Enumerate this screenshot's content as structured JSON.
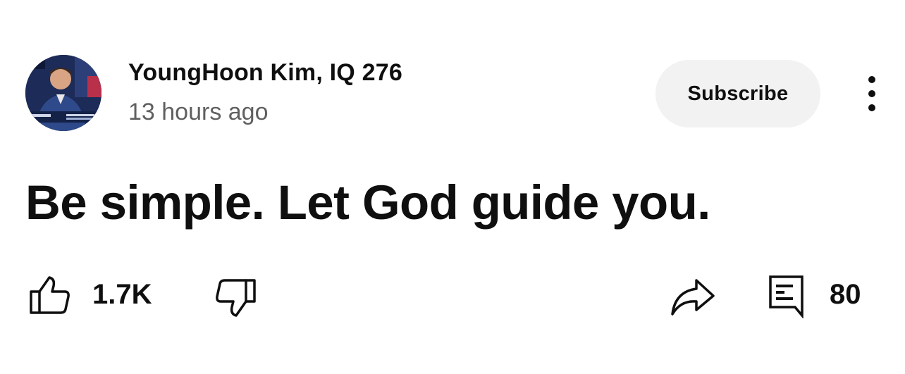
{
  "post": {
    "channel_name": "YoungHoon Kim, IQ 276",
    "timestamp": "13 hours ago",
    "subscribe_label": "Subscribe",
    "text": "Be simple. Let God guide you.",
    "likes": "1.7K",
    "comments": "80"
  },
  "icons": {
    "avatar": "channel-avatar",
    "more": "more-vertical-icon",
    "like": "thumbs-up-icon",
    "dislike": "thumbs-down-icon",
    "share": "share-icon",
    "comment": "comment-icon"
  },
  "colors": {
    "text": "#0f0f0f",
    "secondary_text": "#606060",
    "subscribe_bg": "#f2f2f2",
    "background": "#ffffff"
  }
}
